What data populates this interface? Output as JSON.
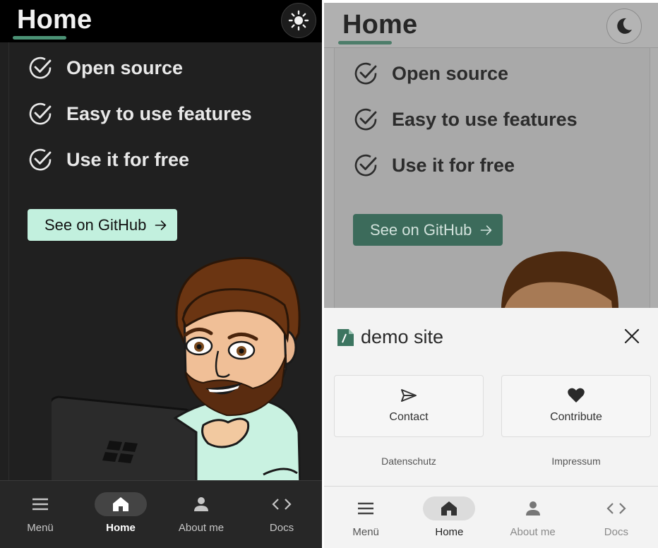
{
  "dark_view": {
    "page_title": "Home",
    "theme_toggle_icon": "sun-icon",
    "features": [
      {
        "icon": "check-circle-icon",
        "label": "Open source"
      },
      {
        "icon": "check-circle-icon",
        "label": "Easy to use features"
      },
      {
        "icon": "check-circle-icon",
        "label": "Use it for free"
      }
    ],
    "cta": {
      "label": "See on GitHub",
      "icon": "arrow-right-icon"
    },
    "nav": [
      {
        "icon": "menu-icon",
        "label": "Menü"
      },
      {
        "icon": "home-icon",
        "label": "Home",
        "active": true
      },
      {
        "icon": "person-icon",
        "label": "About me"
      },
      {
        "icon": "code-icon",
        "label": "Docs"
      }
    ],
    "colors": {
      "accent": "#4b9275",
      "cta_bg": "#c2f0de",
      "background": "#202020"
    }
  },
  "light_view": {
    "page_title": "Home",
    "theme_toggle_icon": "moon-icon",
    "features": [
      {
        "icon": "check-circle-icon",
        "label": "Open source"
      },
      {
        "icon": "check-circle-icon",
        "label": "Easy to use features"
      },
      {
        "icon": "check-circle-icon",
        "label": "Use it for free"
      }
    ],
    "cta": {
      "label": "See on GitHub",
      "icon": "arrow-right-icon"
    },
    "sheet": {
      "brand_icon": "code-file-icon",
      "brand": "demo site",
      "close_icon": "close-icon",
      "cards": [
        {
          "icon": "send-icon",
          "label": "Contact"
        },
        {
          "icon": "heart-icon",
          "label": "Contribute"
        }
      ],
      "links": [
        "Datenschutz",
        "Impressum"
      ]
    },
    "nav": [
      {
        "icon": "menu-icon",
        "label": "Menü"
      },
      {
        "icon": "home-icon",
        "label": "Home",
        "active": true
      },
      {
        "icon": "person-icon",
        "label": "About me"
      },
      {
        "icon": "code-icon",
        "label": "Docs"
      }
    ],
    "colors": {
      "accent": "#4d7d6a",
      "cta_bg": "#3c6b5b",
      "sheet_bg": "#f3f3f3"
    }
  }
}
